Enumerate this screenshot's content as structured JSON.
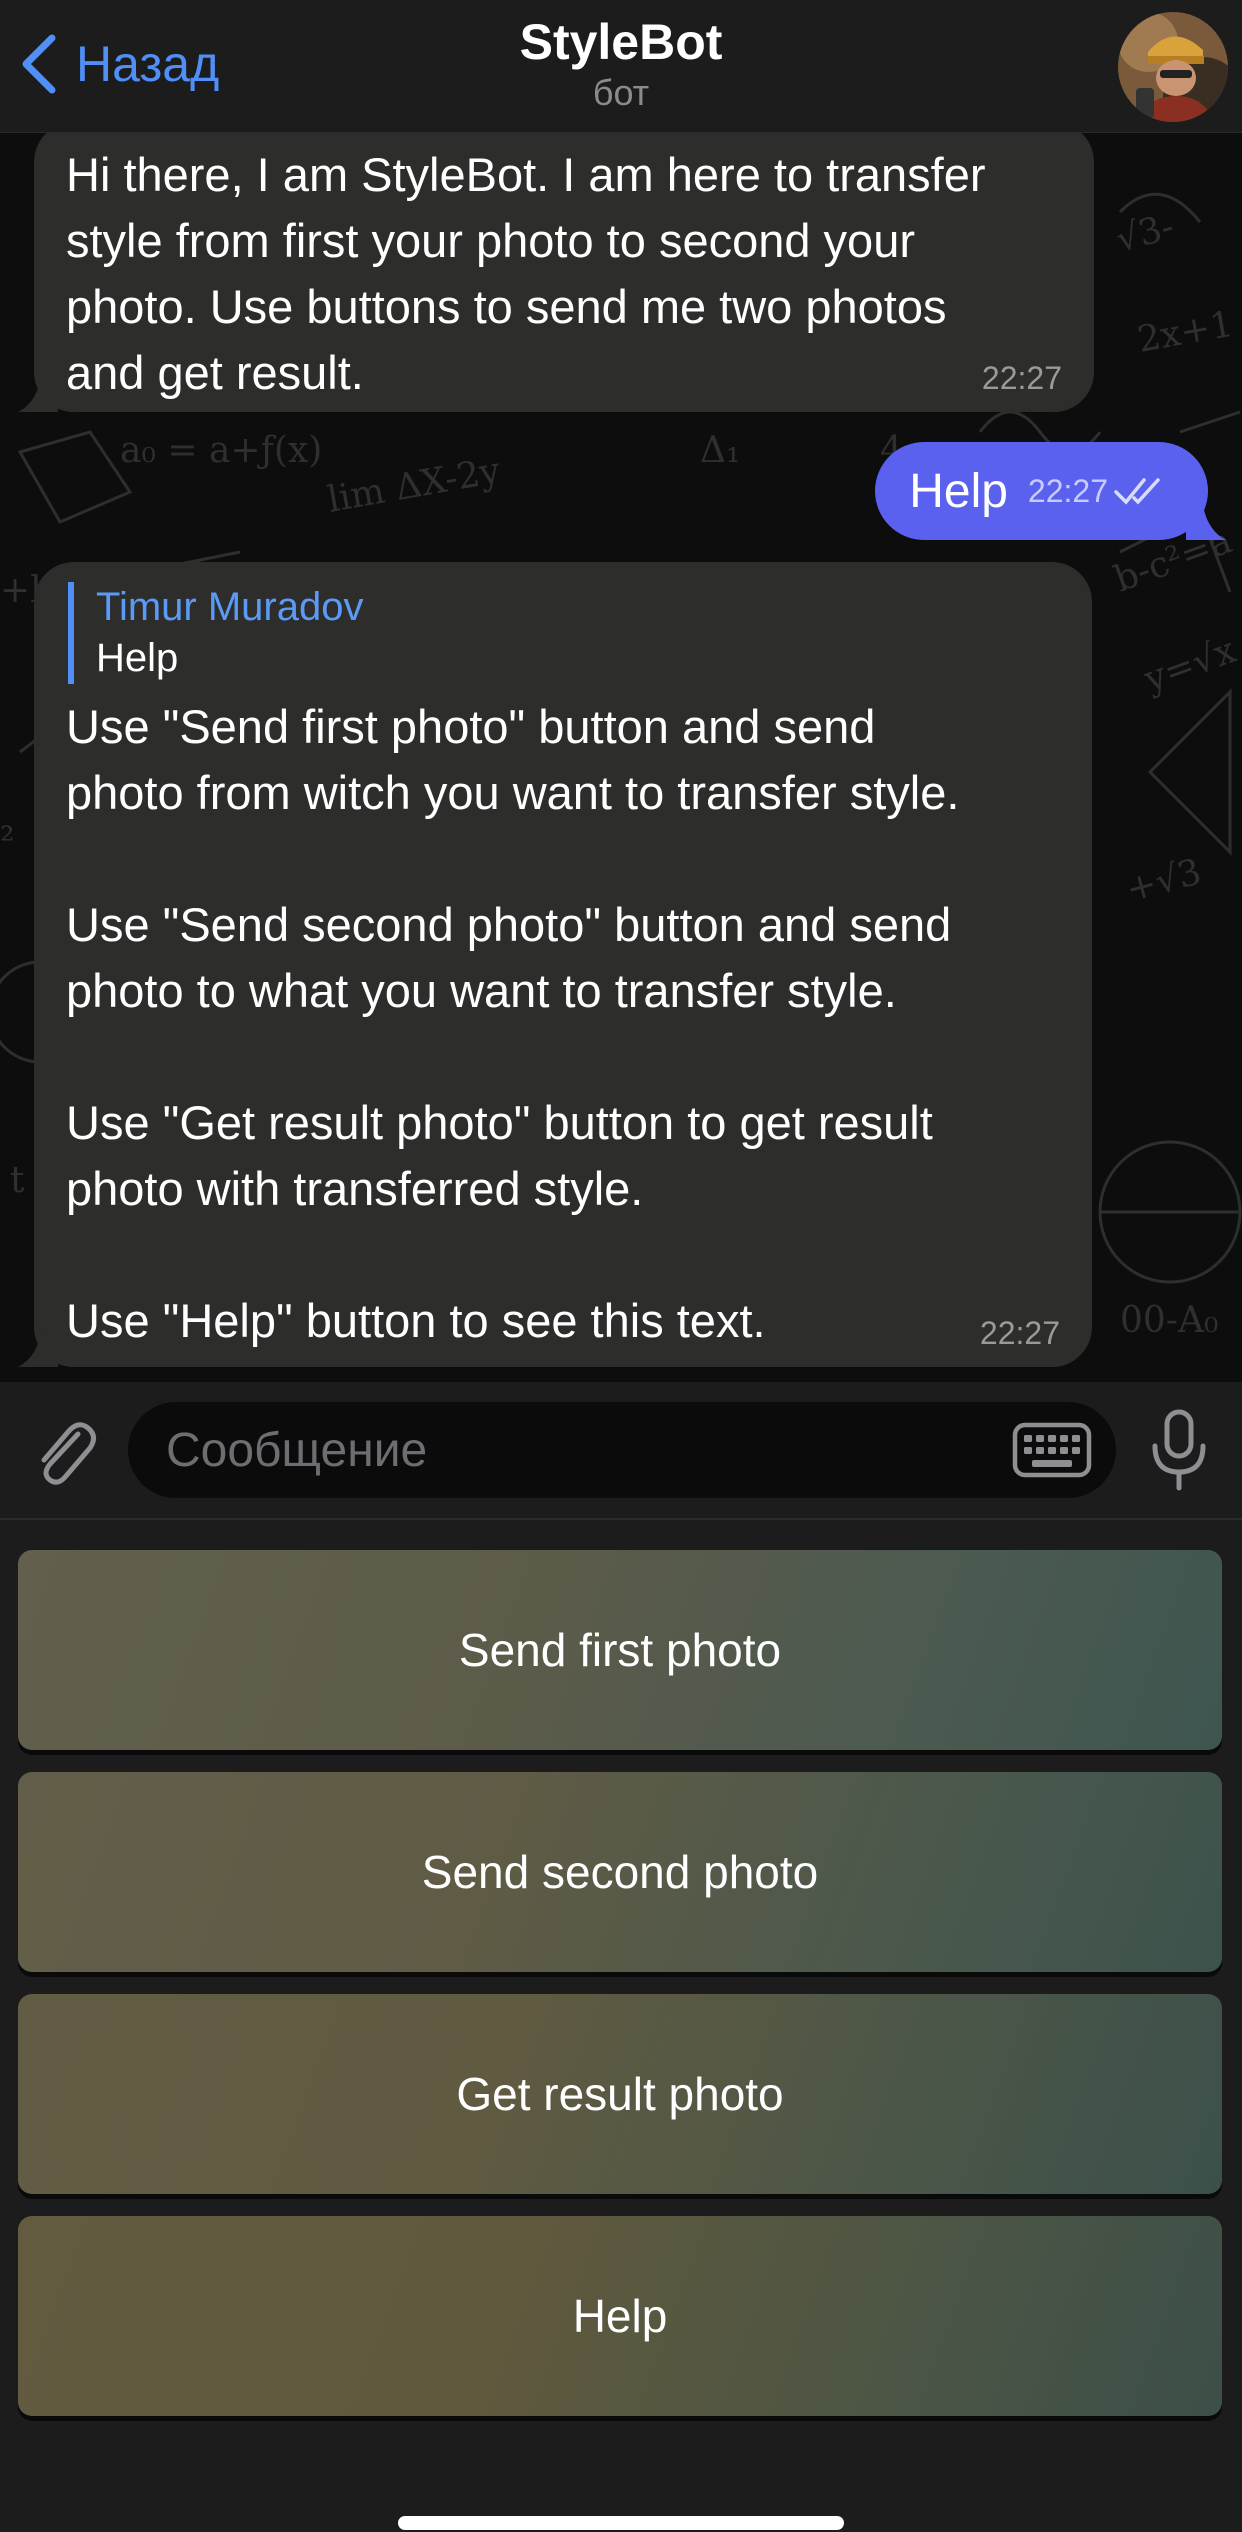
{
  "header": {
    "back_label": "Назад",
    "title": "StyleBot",
    "subtitle": "бот"
  },
  "messages": [
    {
      "direction": "incoming",
      "text": "Hi there, I am StyleBot. I am here to transfer\nstyle from first your photo to second your\nphoto. Use buttons to send me two photos\nand get result.",
      "time": "22:27"
    },
    {
      "direction": "outgoing",
      "text": "Help",
      "time": "22:27",
      "status": "read"
    },
    {
      "direction": "incoming",
      "reply_to": {
        "author": "Timur Muradov",
        "text": "Help"
      },
      "text": "Use \"Send first photo\" button and send\nphoto from witch you want to transfer style.\n\nUse \"Send second photo\" button and send\nphoto to what you want to transfer style.\n\nUse \"Get result photo\" button to get result\nphoto with transferred style.\n\nUse \"Help\" button to see this text.",
      "time": "22:27"
    }
  ],
  "composer": {
    "placeholder": "Сообщение",
    "value": ""
  },
  "keyboard": {
    "buttons": [
      "Send first photo",
      "Send second photo",
      "Get result photo",
      "Help"
    ]
  },
  "icons": {
    "back": "chevron-left-icon",
    "attach": "paperclip-icon",
    "keyboard": "keyboard-icon",
    "mic": "microphone-icon",
    "read": "double-check-icon"
  },
  "colors": {
    "accent": "#4f8ff7",
    "outgoing_bubble": "#5b61ef",
    "incoming_bubble": "#2d2d2b",
    "bar_background": "#1c1c1d"
  }
}
